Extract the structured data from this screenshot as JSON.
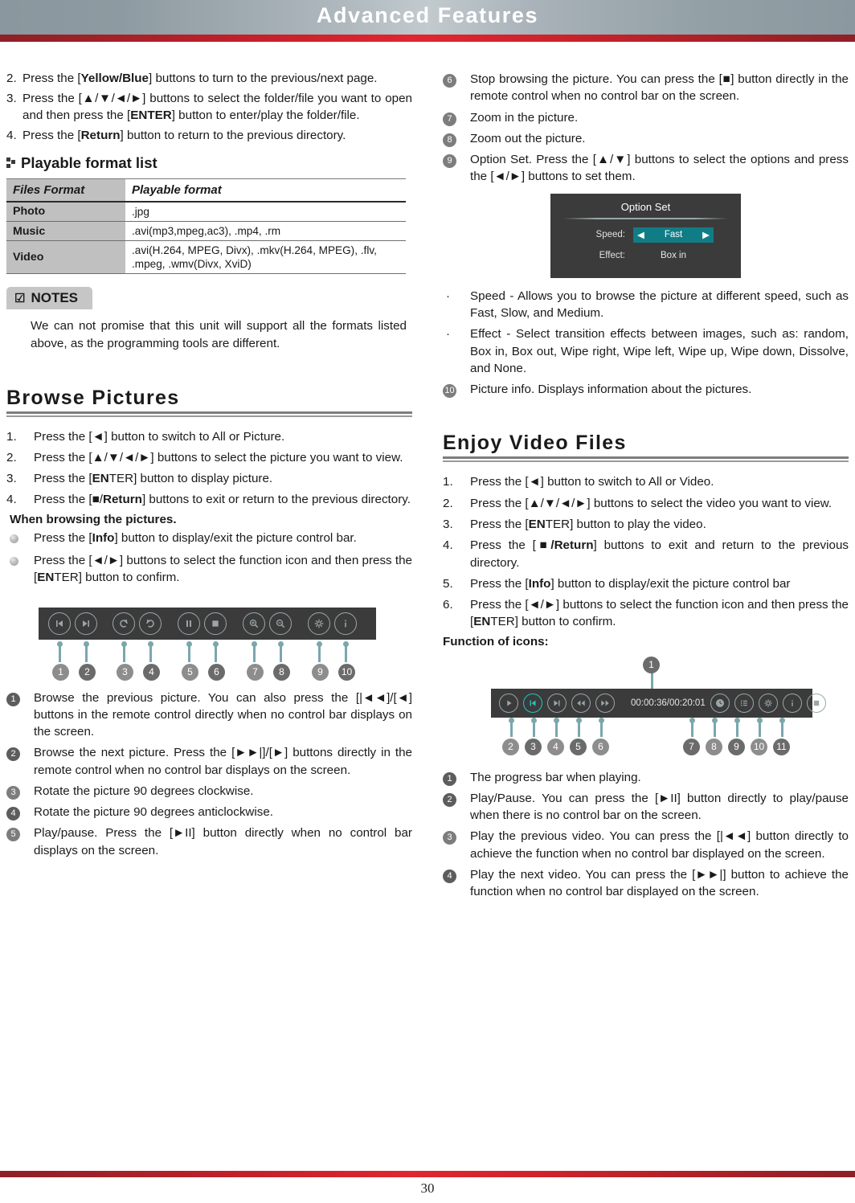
{
  "header": {
    "title": "Advanced Features"
  },
  "footer": {
    "page_number": "30"
  },
  "left": {
    "steps": [
      {
        "num": "2.",
        "parts": [
          {
            "t": "Press the ["
          },
          {
            "t": "Yellow/Blue",
            "b": true
          },
          {
            "t": "] buttons to turn to the previous/next page."
          }
        ]
      },
      {
        "num": "3.",
        "parts": [
          {
            "t": "Press the [▲/▼/◄/►] buttons to select the folder/file you want to open and then press the ["
          },
          {
            "t": "ENTER",
            "b": true
          },
          {
            "t": "] button to enter/play the folder/file."
          }
        ]
      },
      {
        "num": "4.",
        "parts": [
          {
            "t": "Press the ["
          },
          {
            "t": "Return",
            "b": true
          },
          {
            "t": "] button to return to the previous directory."
          }
        ]
      }
    ],
    "subhead": "Playable format list",
    "table": {
      "headers": [
        "Files Format",
        "Playable format"
      ],
      "rows": [
        {
          "format": "Photo",
          "playable": ".jpg"
        },
        {
          "format": "Music",
          "playable": ".avi(mp3,mpeg,ac3), .mp4, .rm"
        },
        {
          "format": "Video",
          "playable": ".avi(H.264, MPEG, Divx), .mkv(H.264, MPEG), .flv, .mpeg, .wmv(Divx, XviD)"
        }
      ]
    },
    "notes": {
      "label": "NOTES",
      "icon": "checkbox-icon",
      "body": "We can not promise that this unit will support all the formats listed above, as the programming tools are different."
    },
    "section": {
      "title": "Browse Pictures"
    },
    "browse_steps": [
      {
        "num": "1.",
        "parts": [
          {
            "t": "Press the [◄] button to switch to All or Picture."
          }
        ]
      },
      {
        "num": "2.",
        "parts": [
          {
            "t": "Press the [▲/▼/◄/►] buttons to select the picture you want to view."
          }
        ]
      },
      {
        "num": "3.",
        "parts": [
          {
            "t": "Press the ["
          },
          {
            "t": "EN",
            "b": true
          },
          {
            "t": "TER] button to display picture."
          }
        ]
      },
      {
        "num": "4.",
        "parts": [
          {
            "t": "Press the [■/"
          },
          {
            "t": "Return",
            "b": true
          },
          {
            "t": "] buttons to exit or return to the previous directory."
          }
        ]
      }
    ],
    "when_browsing_label": "When browsing the pictures.",
    "browse_bullets": [
      {
        "parts": [
          {
            "t": "Press the ["
          },
          {
            "t": "Info",
            "b": true
          },
          {
            "t": "] button to display/exit the picture control bar."
          }
        ]
      },
      {
        "parts": [
          {
            "t": "Press the [◄/►] buttons to select the function icon and then press the ["
          },
          {
            "t": "EN",
            "b": true
          },
          {
            "t": "TER] button to confirm."
          }
        ]
      }
    ],
    "picture_bar": {
      "icons": [
        {
          "name": "skip-previous-icon",
          "marker": "1"
        },
        {
          "name": "skip-next-icon",
          "marker": "2"
        },
        {
          "name": "rotate-clockwise-icon",
          "marker": "3"
        },
        {
          "name": "rotate-anticlockwise-icon",
          "marker": "4"
        },
        {
          "name": "pause-icon",
          "marker": "5"
        },
        {
          "name": "stop-icon",
          "marker": "6"
        },
        {
          "name": "zoom-in-icon",
          "marker": "7"
        },
        {
          "name": "zoom-out-icon",
          "marker": "8"
        },
        {
          "name": "settings-gear-icon",
          "marker": "9"
        },
        {
          "name": "info-icon",
          "marker": "10"
        }
      ]
    },
    "picture_functions": [
      {
        "num": "1",
        "parts": [
          {
            "t": "Browse the previous picture. You can also press the [|◄◄]/[◄] buttons in the remote control directly when no control bar displays on the screen."
          }
        ]
      },
      {
        "num": "2",
        "parts": [
          {
            "t": "Browse the next picture. Press the [►►|]/[►] buttons directly in the remote control when no control bar displays on the screen."
          }
        ]
      },
      {
        "num": "3",
        "parts": [
          {
            "t": "Rotate the picture 90 degrees clockwise."
          }
        ]
      },
      {
        "num": "4",
        "parts": [
          {
            "t": "Rotate the picture 90 degrees anticlockwise."
          }
        ]
      },
      {
        "num": "5",
        "parts": [
          {
            "t": "Play/pause. Press the [►II] button directly when no control bar displays on the screen."
          }
        ]
      }
    ]
  },
  "right": {
    "picture_functions_cont": [
      {
        "num": "6",
        "parts": [
          {
            "t": "Stop browsing the picture. You can press the [■] button directly in the remote control when no control bar on the screen."
          }
        ]
      },
      {
        "num": "7",
        "parts": [
          {
            "t": "Zoom in the picture."
          }
        ]
      },
      {
        "num": "8",
        "parts": [
          {
            "t": "Zoom out the picture."
          }
        ]
      },
      {
        "num": "9",
        "parts": [
          {
            "t": "Option Set. Press the [▲/▼] buttons to select the options and press the [◄/►] buttons to set them."
          }
        ]
      }
    ],
    "option_set": {
      "title": "Option Set",
      "rows": [
        {
          "label": "Speed:",
          "value": "Fast",
          "selected": true,
          "left_arrow": "◀",
          "right_arrow": "▶"
        },
        {
          "label": "Effect:",
          "value": "Box in",
          "selected": false
        }
      ]
    },
    "option_bullets": [
      {
        "parts": [
          {
            "t": "Speed - Allows you to browse the picture at different speed, such as Fast, Slow, and Medium."
          }
        ]
      },
      {
        "parts": [
          {
            "t": "Effect - Select transition effects between images, such as: random, Box in, Box out, Wipe right, Wipe left, Wipe up, Wipe down, Dissolve, and None."
          }
        ]
      }
    ],
    "picture_info": {
      "num": "10",
      "text": "Picture info. Displays information about the pictures."
    },
    "section": {
      "title": "Enjoy Video Files"
    },
    "video_steps": [
      {
        "num": "1.",
        "parts": [
          {
            "t": "Press the [◄] button to switch to All or Video."
          }
        ]
      },
      {
        "num": "2.",
        "parts": [
          {
            "t": "Press the [▲/▼/◄/►] buttons to select the video you want to view."
          }
        ]
      },
      {
        "num": "3.",
        "parts": [
          {
            "t": "Press the ["
          },
          {
            "t": "EN",
            "b": true
          },
          {
            "t": "TER] button to play the video."
          }
        ]
      },
      {
        "num": "4.",
        "parts": [
          {
            "t": "Press the ["
          },
          {
            "t": "■/Return",
            "b": true
          },
          {
            "t": "] buttons to exit and return to the previous directory."
          }
        ]
      },
      {
        "num": "5.",
        "parts": [
          {
            "t": "Press the ["
          },
          {
            "t": "Info",
            "b": true
          },
          {
            "t": "] button to display/exit the picture control bar"
          }
        ]
      },
      {
        "num": "6.",
        "parts": [
          {
            "t": "Press the [◄/►] buttons to select the function icon and then press the ["
          },
          {
            "t": "EN",
            "b": true
          },
          {
            "t": "TER] button to confirm."
          }
        ]
      }
    ],
    "function_of_icons_label": "Function of icons:",
    "video_bar": {
      "time": "00:00:36/00:20:01",
      "progress_marker": "1",
      "icons": [
        {
          "name": "play-icon",
          "marker": "2",
          "highlight": false
        },
        {
          "name": "skip-previous-icon",
          "marker": "3",
          "highlight": true
        },
        {
          "name": "skip-next-icon",
          "marker": "4",
          "highlight": false
        },
        {
          "name": "rewind-icon",
          "marker": "5",
          "highlight": false
        },
        {
          "name": "fast-forward-icon",
          "marker": "6",
          "highlight": false
        },
        {
          "name": "clock-time-icon",
          "marker": "7",
          "highlight": false
        },
        {
          "name": "playlist-icon",
          "marker": "8",
          "highlight": false
        },
        {
          "name": "settings-gear-icon",
          "marker": "9",
          "highlight": false
        },
        {
          "name": "info-icon",
          "marker": "10",
          "highlight": false
        },
        {
          "name": "stop-icon",
          "marker": "11",
          "highlight": false
        }
      ]
    },
    "video_functions": [
      {
        "num": "1",
        "parts": [
          {
            "t": "The progress bar when playing."
          }
        ]
      },
      {
        "num": "2",
        "parts": [
          {
            "t": "Play/Pause. You can press the [►II] button directly to play/pause when there is no control bar on the screen."
          }
        ]
      },
      {
        "num": "3",
        "parts": [
          {
            "t": "Play the previous video. You can press the [|◄◄] button directly to achieve the function when no control bar displayed on the screen."
          }
        ]
      },
      {
        "num": "4",
        "parts": [
          {
            "t": "Play the next video. You can press the [►►|] button to achieve the function when no control bar displayed on the screen."
          }
        ]
      }
    ]
  }
}
